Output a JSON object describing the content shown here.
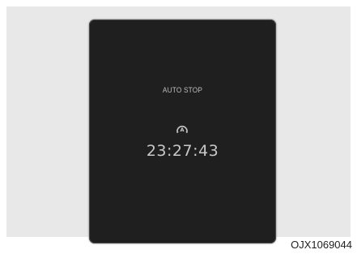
{
  "display": {
    "status_text": "AUTO STOP",
    "timer": "23:27:43",
    "icon": "auto-stop-indicator-icon"
  },
  "figure_code": "OJX1069044",
  "colors": {
    "background_panel": "#e8e8e8",
    "screen": "#1f1f1f",
    "text_light": "#c8c8c8"
  }
}
